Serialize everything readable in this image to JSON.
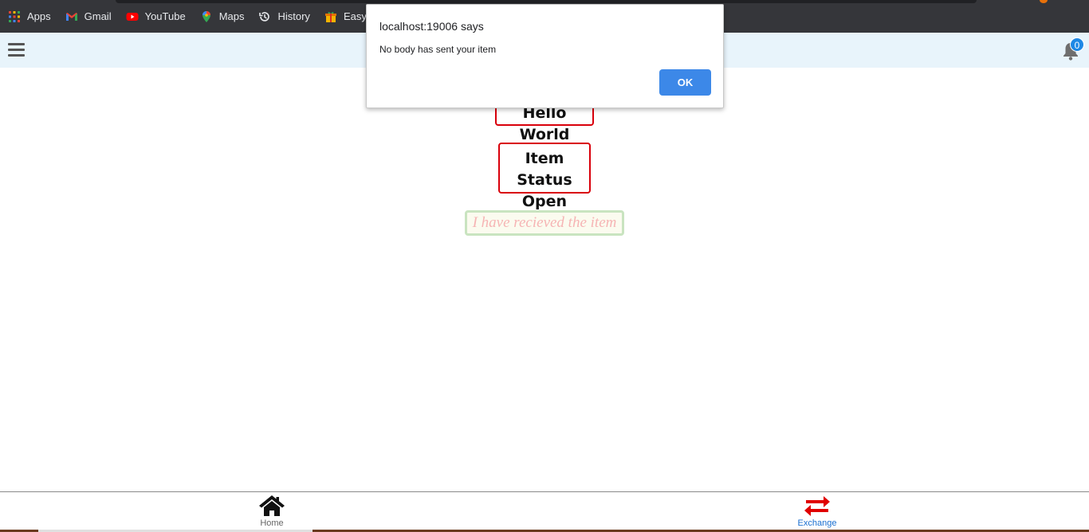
{
  "bookmarks": [
    {
      "label": "Apps",
      "icon": "apps-grid-icon"
    },
    {
      "label": "Gmail",
      "icon": "gmail-icon"
    },
    {
      "label": "YouTube",
      "icon": "youtube-icon"
    },
    {
      "label": "Maps",
      "icon": "maps-pin-icon"
    },
    {
      "label": "History",
      "icon": "history-icon"
    },
    {
      "label": "EasyRewa",
      "icon": "gift-icon"
    }
  ],
  "header": {
    "notification_count": "0"
  },
  "main": {
    "hello_text": "Hello World",
    "status_label": "Item Status",
    "status_value": "Open",
    "received_button_label": "I have recieved the item"
  },
  "alert": {
    "title": "localhost:19006 says",
    "message": "No body has sent your item",
    "ok_label": "OK"
  },
  "bottom_nav": {
    "home_label": "Home",
    "exchange_label": "Exchange"
  },
  "colors": {
    "box_border": "#d9000b",
    "header_bg": "#e8f4fb",
    "active_nav": "#1a6fd0",
    "exchange_icon": "#e00000",
    "ok_button": "#3c88e8"
  }
}
